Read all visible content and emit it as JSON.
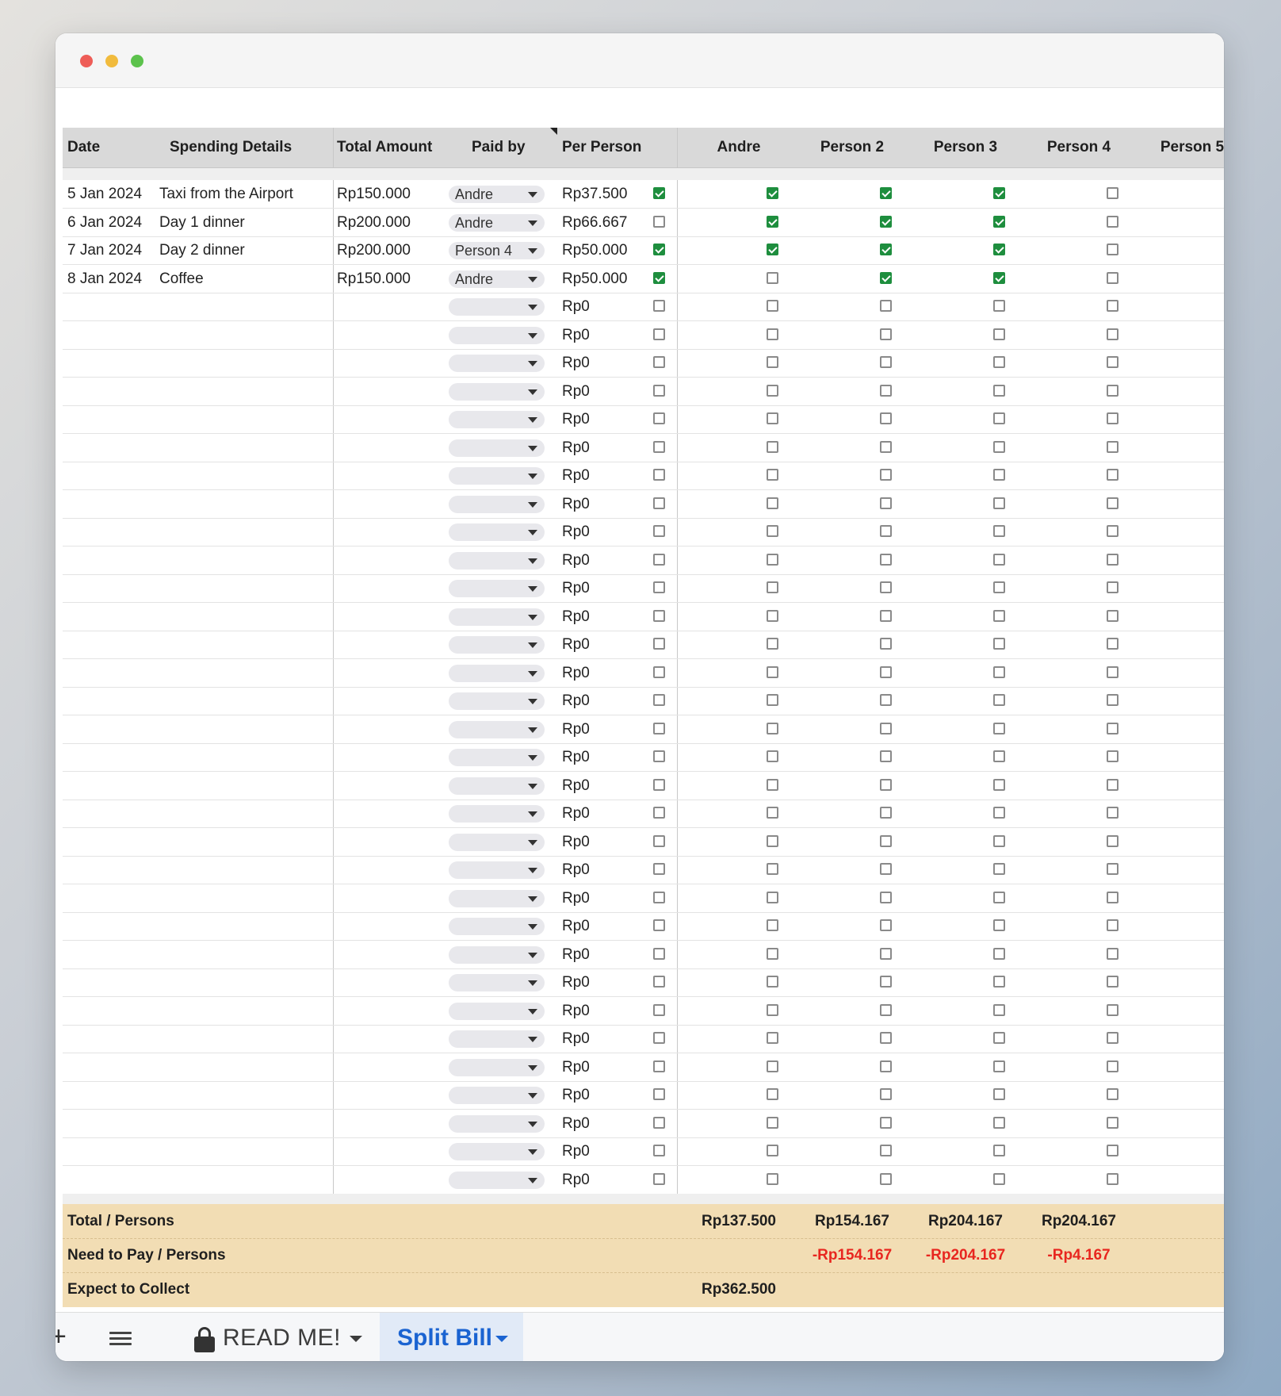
{
  "headers": {
    "date": "Date",
    "details": "Spending Details",
    "total": "Total Amount",
    "paid_by": "Paid by",
    "per_person": "Per Person",
    "people": [
      "Andre",
      "Person 2",
      "Person 3",
      "Person 4",
      "Person 5"
    ]
  },
  "rows": [
    {
      "date": "5 Jan  2024",
      "details": "Taxi from the Airport",
      "amount": "Rp150.000",
      "paid_by": "Andre",
      "per_person": "Rp37.500",
      "checks": [
        true,
        true,
        true,
        true,
        false
      ]
    },
    {
      "date": "6 Jan  2024",
      "details": "Day 1 dinner",
      "amount": "Rp200.000",
      "paid_by": "Andre",
      "per_person": "Rp66.667",
      "checks": [
        false,
        true,
        true,
        true,
        false
      ]
    },
    {
      "date": "7 Jan  2024",
      "details": "Day 2 dinner",
      "amount": "Rp200.000",
      "paid_by": "Person 4",
      "per_person": "Rp50.000",
      "checks": [
        true,
        true,
        true,
        true,
        false
      ]
    },
    {
      "date": "8 Jan  2024",
      "details": "Coffee",
      "amount": "Rp150.000",
      "paid_by": "Andre",
      "per_person": "Rp50.000",
      "checks": [
        true,
        false,
        true,
        true,
        false
      ]
    }
  ],
  "empty_rows": {
    "count": 32,
    "per_person": "Rp0"
  },
  "summary": {
    "total_label": "Total / Persons",
    "total_values": [
      "Rp137.500",
      "Rp154.167",
      "Rp204.167",
      "Rp204.167",
      ""
    ],
    "need_label": "Need to Pay / Persons",
    "need_values": [
      "",
      "-Rp154.167",
      "-Rp204.167",
      "-Rp4.167",
      ""
    ],
    "collect_label": "Expect to Collect",
    "collect_value": "Rp362.500"
  },
  "tabs": {
    "add": "+",
    "readme": "READ ME!",
    "split": "Split Bill"
  },
  "colors": {
    "summary_bg": "#f2ddb4",
    "negative": "#e8261f",
    "checked": "#1e8e3e",
    "active_tab": "#1a63d1"
  }
}
